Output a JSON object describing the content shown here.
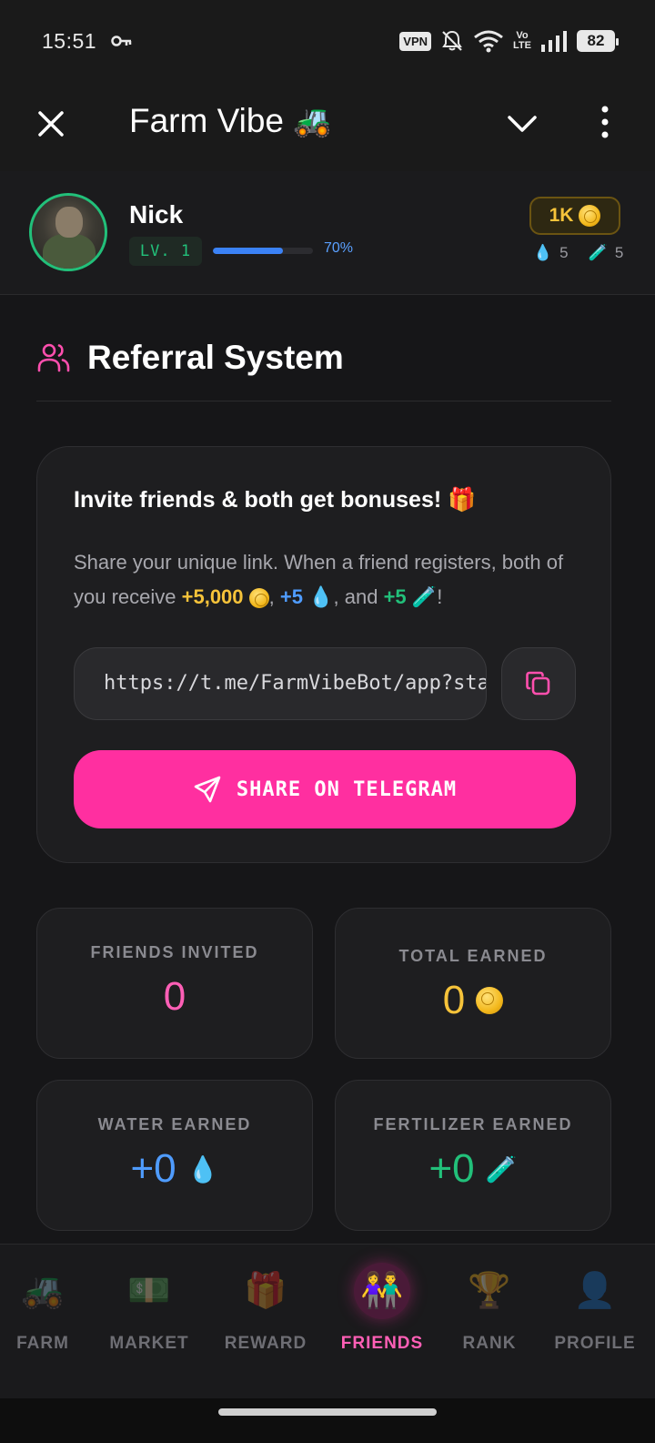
{
  "status": {
    "time": "15:51",
    "vpn": "VPN",
    "volte_top": "Vo",
    "volte_bottom": "LTE",
    "battery": "82"
  },
  "app": {
    "title": "Farm Vibe",
    "title_emoji": "🚜"
  },
  "user": {
    "name": "Nick",
    "level": "LV. 1",
    "xp_percent_label": "70%",
    "xp_fraction": 0.7,
    "coins": "1K",
    "water": "5",
    "fertilizer": "5"
  },
  "section": {
    "title": "Referral System"
  },
  "invite": {
    "heading": "Invite friends & both get bonuses! 🎁",
    "desc_prefix": "Share your unique link. When a friend registers, both of you receive ",
    "bonus_coins": "+5,000",
    "sep1": ", ",
    "bonus_water": "+5",
    "sep2": ", and ",
    "bonus_fert": "+5",
    "desc_suffix": "!",
    "link": "https://t.me/FarmVibeBot/app?startapp=ref_Nick",
    "share_label": "SHARE ON TELEGRAM"
  },
  "stats": {
    "friends_invited_label": "FRIENDS INVITED",
    "friends_invited_value": "0",
    "total_earned_label": "TOTAL EARNED",
    "total_earned_value": "0",
    "water_earned_label": "WATER EARNED",
    "water_earned_value": "+0",
    "fert_earned_label": "FERTILIZER EARNED",
    "fert_earned_value": "+0"
  },
  "nav": {
    "items": [
      {
        "label": "FARM",
        "emoji": "🚜"
      },
      {
        "label": "MARKET",
        "emoji": "💵"
      },
      {
        "label": "REWARD",
        "emoji": "🎁"
      },
      {
        "label": "FRIENDS",
        "emoji": "👫"
      },
      {
        "label": "RANK",
        "emoji": "🏆"
      },
      {
        "label": "PROFILE",
        "emoji": "👤"
      }
    ],
    "active": "FRIENDS"
  },
  "colors": {
    "accent_pink": "#ff2fa0",
    "gold": "#f6c33a",
    "water_blue": "#4f9cff",
    "fert_green": "#22c07a"
  }
}
